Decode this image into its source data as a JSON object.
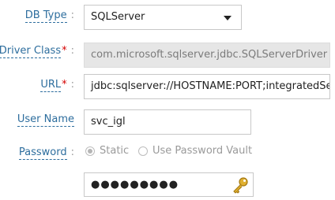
{
  "labels": {
    "db_type": "DB Type",
    "driver_class": "Driver Class",
    "url": "URL",
    "user_name": "User Name",
    "password": "Password",
    "separator": ":",
    "required": "*"
  },
  "fields": {
    "db_type": "SQLServer",
    "driver_class": "com.microsoft.sqlserver.jdbc.SQLServerDriver",
    "url": "jdbc:sqlserver://HOSTNAME:PORT;integratedSecu",
    "user_name": "svc_igl",
    "password_masked": "●●●●●●●●●"
  },
  "password_options": {
    "static": "Static",
    "vault": "Use Password Vault",
    "selected": "Static"
  },
  "icons": {
    "password_key": "key-icon",
    "dropdown": "chevron-down-icon"
  },
  "colors": {
    "label": "#2e6e9e",
    "required": "#d40000",
    "key": "#d4a020"
  }
}
